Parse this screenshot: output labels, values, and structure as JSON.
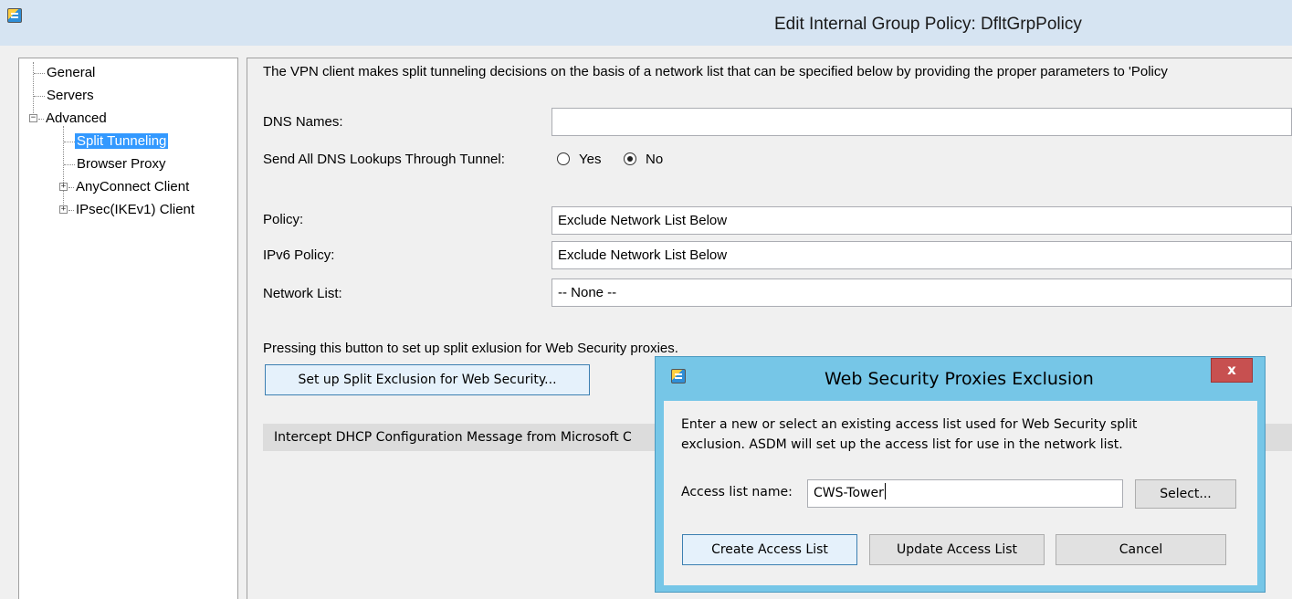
{
  "window": {
    "title": "Edit Internal Group Policy: DfltGrpPolicy",
    "icon": "asdm-app-icon"
  },
  "tree": {
    "items": [
      {
        "label": "General"
      },
      {
        "label": "Servers"
      },
      {
        "label": "Advanced",
        "expanded": true
      },
      {
        "label": "Split Tunneling",
        "selected": true
      },
      {
        "label": "Browser Proxy"
      },
      {
        "label": "AnyConnect Client",
        "expanded": false
      },
      {
        "label": "IPsec(IKEv1) Client",
        "expanded": false
      }
    ]
  },
  "content": {
    "intro": "The VPN client makes split tunneling decisions on the basis of a network list that can be specified below by providing the proper parameters to 'Policy",
    "dns_names": {
      "label": "DNS Names:",
      "value": ""
    },
    "send_dns": {
      "label": "Send All DNS Lookups Through Tunnel:",
      "options": [
        "Yes",
        "No"
      ],
      "selected": "No"
    },
    "policy": {
      "label": "Policy:",
      "value": "Exclude Network List Below"
    },
    "ipv6_policy": {
      "label": "IPv6 Policy:",
      "value": "Exclude Network List Below"
    },
    "network_list": {
      "label": "Network List:",
      "value": "-- None --"
    },
    "exclusion_note": "Pressing this button to set up split exlusion for Web Security proxies.",
    "setup_button": "Set up Split Exclusion for Web Security...",
    "dhcp_section": "Intercept DHCP Configuration Message from Microsoft C"
  },
  "dialog": {
    "title": "Web Security Proxies Exclusion",
    "close_label": "x",
    "description_line1": "Enter a new or select an existing access list used for Web Security split",
    "description_line2": "exclusion. ASDM will set up the access list for use in the network list.",
    "access_list_label": "Access list name:",
    "access_list_value": "CWS-Tower",
    "select_button": "Select...",
    "create_button": "Create Access List",
    "update_button": "Update Access List",
    "cancel_button": "Cancel"
  },
  "colors": {
    "titlebar": "#d6e4f2",
    "dialog_frame": "#76c6e7",
    "close_button": "#c75050",
    "selection": "#3399ff"
  }
}
